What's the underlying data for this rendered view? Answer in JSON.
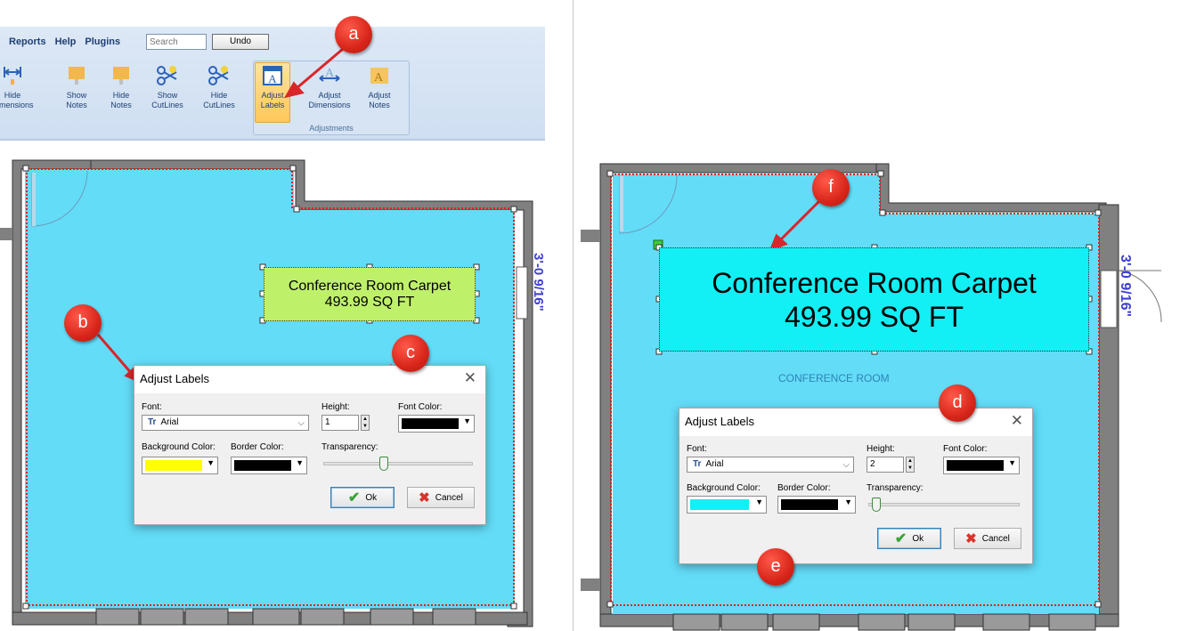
{
  "left": {
    "menu": [
      "Reports",
      "Help",
      "Plugins"
    ],
    "search_placeholder": "Search",
    "undo_label": "Undo",
    "ribbon_buttons": [
      {
        "label": "Hide\nDimensions",
        "icon": "dimension-arrows-icon"
      },
      {
        "label": "Show\nNotes",
        "icon": "sticky-note-pin-icon"
      },
      {
        "label": "Hide\nNotes",
        "icon": "sticky-note-pin-icon"
      },
      {
        "label": "Show\nCutLines",
        "icon": "scissors-cutline-icon"
      },
      {
        "label": "Hide\nCutLines",
        "icon": "scissors-cutline-icon"
      },
      {
        "label": "Adjust\nLabels",
        "icon": "label-a-icon",
        "active": true
      },
      {
        "label": "Adjust\nDimensions",
        "icon": "dimension-a-icon"
      },
      {
        "label": "Adjust\nNotes",
        "icon": "note-a-icon"
      }
    ],
    "group_label": "Adjustments",
    "label": {
      "line1": "Conference Room Carpet",
      "line2": "493.99 SQ FT",
      "bg": "#bff06a"
    },
    "dimension": "3'-0 9/16\"",
    "dialog": {
      "title": "Adjust Labels",
      "font_label": "Font:",
      "font_value": "Arial",
      "height_label": "Height:",
      "height_value": "1",
      "font_color_label": "Font Color:",
      "font_color": "#000000",
      "bg_color_label": "Background Color:",
      "bg_color": "#ffff00",
      "border_color_label": "Border Color:",
      "border_color": "#000000",
      "transparency_label": "Transparency:",
      "transparency": 0.45,
      "ok_label": "Ok",
      "cancel_label": "Cancel"
    },
    "callouts": [
      "a",
      "b",
      "c"
    ]
  },
  "right": {
    "label": {
      "line1": "Conference Room Carpet",
      "line2": "493.99 SQ FT",
      "bg": "#12eff5"
    },
    "dimension": "3'-0 9/16\"",
    "room_name": "CONFERENCE ROOM",
    "dialog": {
      "title": "Adjust Labels",
      "font_label": "Font:",
      "font_value": "Arial",
      "height_label": "Height:",
      "height_value": "2",
      "font_color_label": "Font Color:",
      "font_color": "#000000",
      "bg_color_label": "Background Color:",
      "bg_color": "#12eff5",
      "border_color_label": "Border Color:",
      "border_color": "#000000",
      "transparency_label": "Transparency:",
      "transparency": 0.06,
      "ok_label": "Ok",
      "cancel_label": "Cancel"
    },
    "callouts": [
      "d",
      "e",
      "f"
    ]
  },
  "colors": {
    "room_fill": "#63dcf8",
    "wall": "#808080",
    "cutline": "#e0201c",
    "arrow": "#d9262a"
  }
}
